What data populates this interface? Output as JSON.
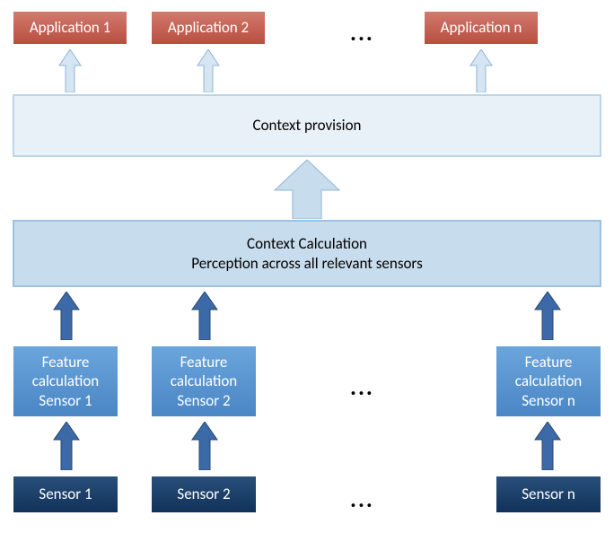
{
  "apps": [
    "Application 1",
    "Application 2",
    "Application n"
  ],
  "provision": "Context provision",
  "calculation": {
    "line1": "Context Calculation",
    "line2": "Perception across all relevant sensors"
  },
  "features": [
    "Feature calculation Sensor 1",
    "Feature calculation Sensor 2",
    "Feature calculation Sensor n"
  ],
  "sensors": [
    "Sensor 1",
    "Sensor 2",
    "Sensor n"
  ],
  "ellipsis": "..."
}
